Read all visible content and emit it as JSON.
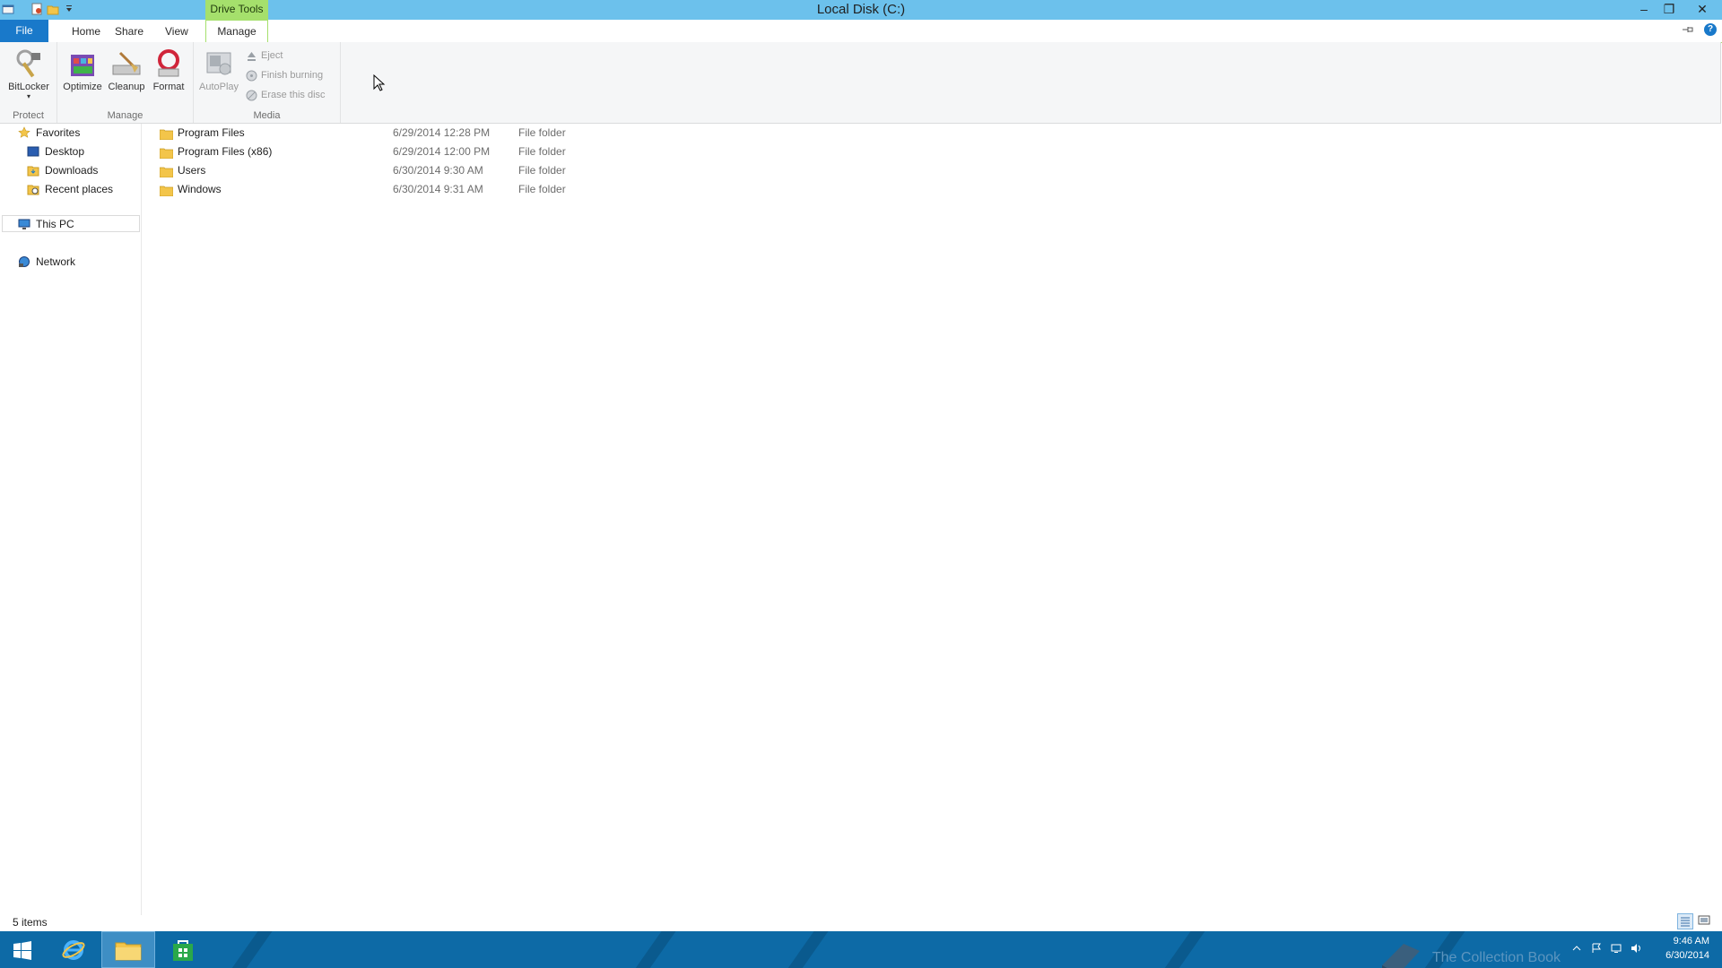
{
  "window": {
    "title": "Local Disk (C:)",
    "context_tab_group": "Drive Tools",
    "buttons": {
      "minimize": "‒",
      "restore": "❐",
      "close": "✕"
    }
  },
  "tabs": [
    {
      "label": "File"
    },
    {
      "label": "Home"
    },
    {
      "label": "Share"
    },
    {
      "label": "View"
    },
    {
      "label": "Manage"
    }
  ],
  "ribbon": {
    "groups": {
      "protect": {
        "label": "Protect",
        "bitlocker": "BitLocker"
      },
      "manage": {
        "label": "Manage",
        "optimize": "Optimize",
        "cleanup": "Cleanup",
        "format": "Format"
      },
      "media": {
        "label": "Media",
        "autoplay": "AutoPlay",
        "eject": "Eject",
        "finish_burning": "Finish burning",
        "erase_disc": "Erase this disc"
      }
    }
  },
  "nav": {
    "favorites": "Favorites",
    "desktop": "Desktop",
    "downloads": "Downloads",
    "recent": "Recent places",
    "this_pc": "This PC",
    "network": "Network"
  },
  "files": [
    {
      "name": "Program Files",
      "date": "6/29/2014 12:28 PM",
      "type": "File folder"
    },
    {
      "name": "Program Files (x86)",
      "date": "6/29/2014 12:00 PM",
      "type": "File folder"
    },
    {
      "name": "Users",
      "date": "6/30/2014 9:30 AM",
      "type": "File folder"
    },
    {
      "name": "Windows",
      "date": "6/30/2014 9:31 AM",
      "type": "File folder"
    }
  ],
  "status": {
    "item_count": "5 items"
  },
  "taskbar": {
    "time": "9:46 AM",
    "date": "6/30/2014",
    "watermark": "The Collection Book"
  },
  "colors": {
    "titlebar": "#6cc1ec",
    "file_tab": "#1979ca",
    "context_tab": "#a5e06c",
    "taskbar": "#0d6aa6"
  }
}
